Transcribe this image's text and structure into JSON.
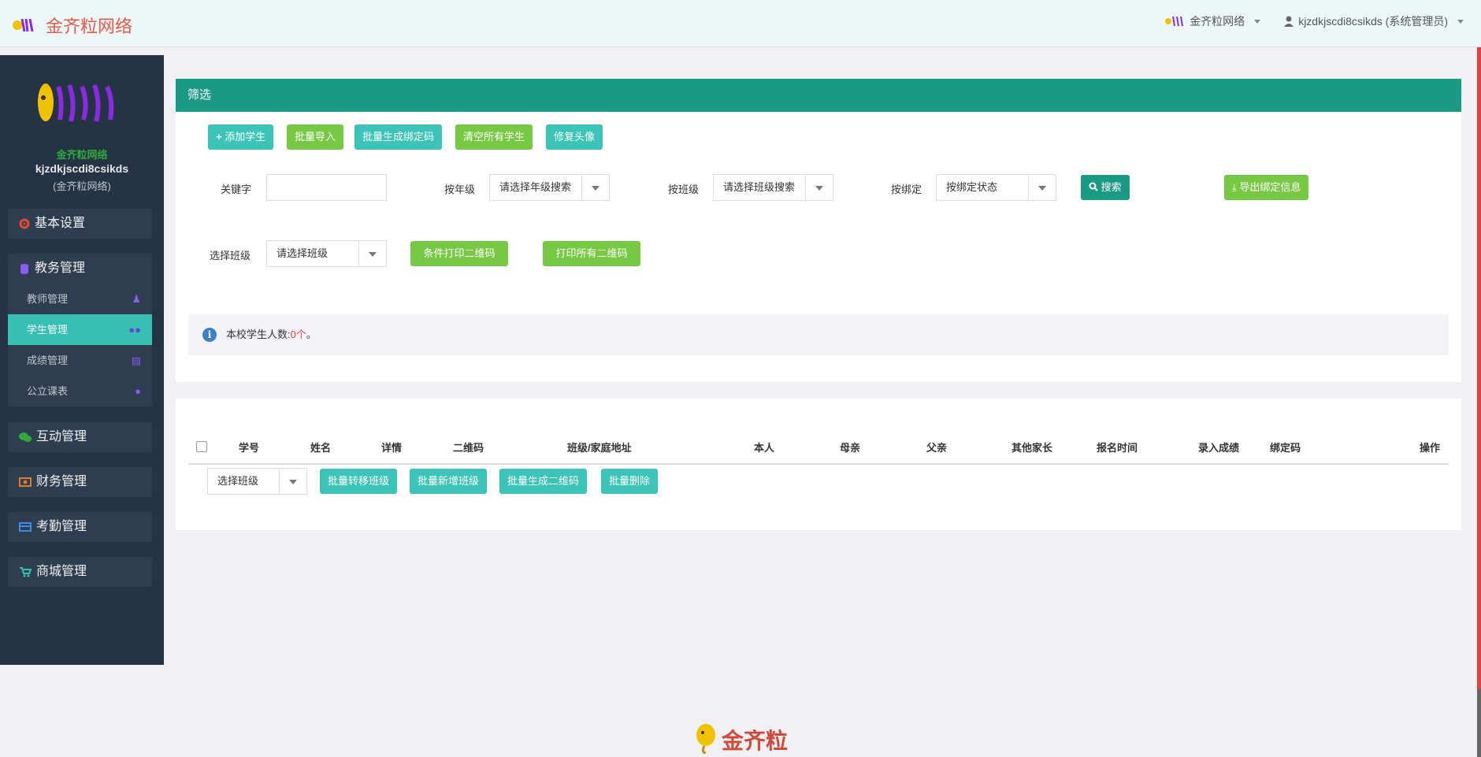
{
  "header": {
    "brand": "金齐粒网络",
    "school_menu": "金齐粒网络",
    "user_menu": "kjzdkjscdi8csikds (系统管理员)"
  },
  "sidebar": {
    "school": "金齐粒网络",
    "username": "kjzdkjscdi8csikds",
    "role": "(金齐粒网络)",
    "groups": [
      {
        "label": "基本设置"
      },
      {
        "label": "教务管理",
        "items": [
          "教师管理",
          "学生管理",
          "成绩管理",
          "公立课表"
        ]
      },
      {
        "label": "互动管理"
      },
      {
        "label": "财务管理"
      },
      {
        "label": "考勤管理"
      },
      {
        "label": "商城管理"
      }
    ]
  },
  "filter_panel": {
    "title": "筛选",
    "buttons": {
      "add_student": "添加学生",
      "batch_import": "批量导入",
      "batch_bind_code": "批量生成绑定码",
      "clear_all": "清空所有学生",
      "fix_avatar": "修复头像"
    },
    "keyword_label": "关键字",
    "keyword_value": "",
    "grade_label": "按年级",
    "grade_select": "请选择年级搜索",
    "class_label": "按班级",
    "class_select": "请选择班级搜索",
    "bind_label": "按绑定",
    "bind_select": "按绑定状态",
    "search_button": "搜索",
    "export_button": "导出绑定信息",
    "print_class_label": "选择班级",
    "print_class_select": "请选择班级",
    "print_condition_button": "条件打印二维码",
    "print_all_button": "打印所有二维码",
    "info_prefix": "本校学生人数:",
    "info_count": "0个",
    "info_suffix": "。"
  },
  "table": {
    "columns": [
      "学号",
      "姓名",
      "详情",
      "二维码",
      "班级/家庭地址",
      "本人",
      "母亲",
      "父亲",
      "其他家长",
      "报名时间",
      "录入成绩",
      "绑定码",
      "操作"
    ],
    "class_select": "选择班级",
    "batch_move": "批量转移班级",
    "batch_add_class": "批量新增班级",
    "batch_qr": "批量生成二维码",
    "batch_delete": "批量删除"
  },
  "footer": {
    "logo_text": "金齐粒"
  },
  "colors": {
    "accent": "#1a9a85",
    "teal_button": "#3cc4b8",
    "green_button": "#77c944",
    "sidebar_bg": "#253444",
    "brand_red": "#e05a4a"
  }
}
